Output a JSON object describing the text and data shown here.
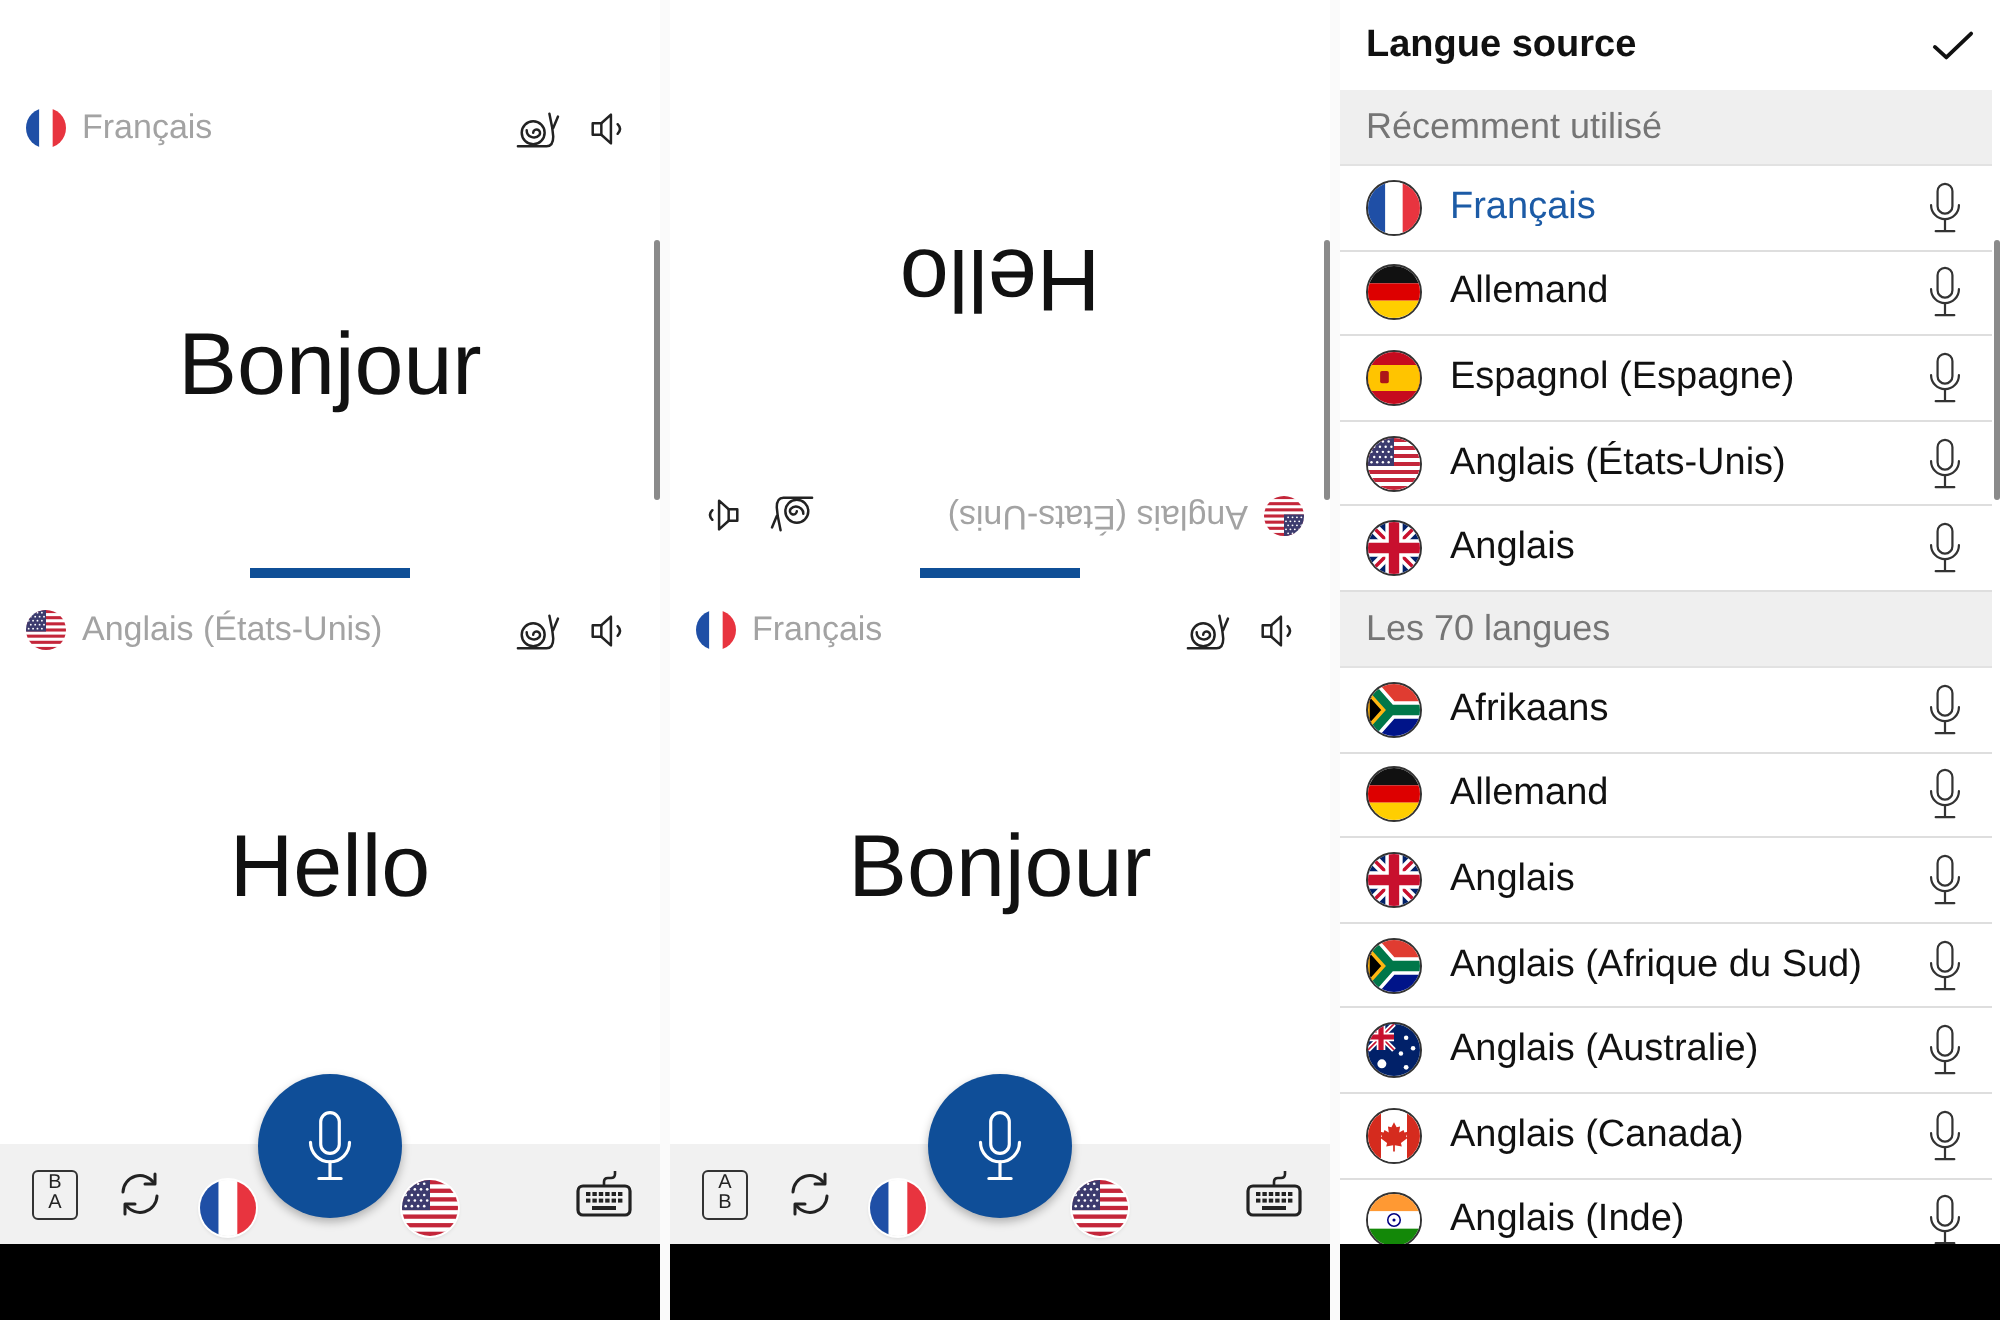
{
  "phones": [
    {
      "halves": [
        {
          "flipped": false,
          "kind": "france",
          "language": "Français",
          "text": "Bonjour"
        },
        {
          "flipped": false,
          "kind": "usa",
          "language": "Anglais (États-Unis)",
          "text": "Hello"
        }
      ],
      "toolbar": {
        "order_button": [
          "B",
          "A"
        ],
        "language_buttons": [
          {
            "kind": "france"
          },
          {
            "kind": "usa"
          }
        ]
      }
    },
    {
      "halves": [
        {
          "flipped": true,
          "kind": "usa",
          "language": "Anglais (États-Unis)",
          "text": "Hello"
        },
        {
          "flipped": false,
          "kind": "france",
          "language": "Français",
          "text": "Bonjour"
        }
      ],
      "toolbar": {
        "order_button": [
          "A",
          "B"
        ],
        "language_buttons": [
          {
            "kind": "france"
          },
          {
            "kind": "usa"
          }
        ]
      }
    }
  ],
  "language_picker": {
    "title": "Langue source",
    "sections": [
      {
        "title": "Récemment utilisé",
        "items": [
          {
            "name": "Français",
            "kind": "france",
            "selected": true
          },
          {
            "name": "Allemand",
            "kind": "germany",
            "selected": false
          },
          {
            "name": "Espagnol (Espagne)",
            "kind": "spain",
            "selected": false
          },
          {
            "name": "Anglais (États-Unis)",
            "kind": "usa",
            "selected": false
          },
          {
            "name": "Anglais",
            "kind": "britain",
            "selected": false
          }
        ]
      },
      {
        "title": "Les 70 langues",
        "items": [
          {
            "name": "Afrikaans",
            "kind": "southafrica",
            "selected": false
          },
          {
            "name": "Allemand",
            "kind": "germany",
            "selected": false
          },
          {
            "name": "Anglais",
            "kind": "britain",
            "selected": false
          },
          {
            "name": "Anglais (Afrique du Sud)",
            "kind": "southafrica",
            "selected": false
          },
          {
            "name": "Anglais (Australie)",
            "kind": "australia",
            "selected": false
          },
          {
            "name": "Anglais (Canada)",
            "kind": "canada",
            "selected": false
          },
          {
            "name": "Anglais (Inde)",
            "kind": "india",
            "selected": false
          }
        ]
      }
    ]
  }
}
